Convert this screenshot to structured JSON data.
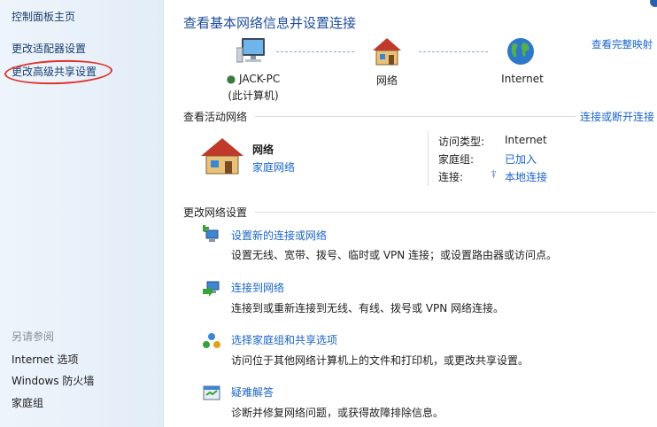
{
  "sidebar": {
    "home_link": "控制面板主页",
    "adapter_link": "更改适配器设置",
    "advanced_sharing_link": "更改高级共享设置",
    "see_also_heading": "另请参阅",
    "see_also": [
      "Internet 选项",
      "Windows 防火墙",
      "家庭组"
    ]
  },
  "header": {
    "title": "查看基本网络信息并设置连接",
    "full_map_link": "查看完整映射"
  },
  "network_map": {
    "computer_name": "JACK-PC",
    "computer_sub": "(此计算机)",
    "network_label": "网络",
    "internet_label": "Internet"
  },
  "active_networks": {
    "title": "查看活动网络",
    "connect_link": "连接或断开连接",
    "network_name": "网络",
    "network_type": "家庭网络",
    "access_type_label": "访问类型:",
    "access_type_value": "Internet",
    "homegroup_label": "家庭组:",
    "homegroup_value": "已加入",
    "connections_label": "连接:",
    "connections_value": "本地连接"
  },
  "change_settings": {
    "title": "更改网络设置",
    "tasks": [
      {
        "link": "设置新的连接或网络",
        "desc": "设置无线、宽带、拨号、临时或 VPN 连接；或设置路由器或访问点。"
      },
      {
        "link": "连接到网络",
        "desc": "连接到或重新连接到无线、有线、拨号或 VPN 网络连接。"
      },
      {
        "link": "选择家庭组和共享选项",
        "desc": "访问位于其他网络计算机上的文件和打印机，或更改共享设置。"
      },
      {
        "link": "疑难解答",
        "desc": "诊断并修复网络问题，或获得故障排除信息。"
      }
    ]
  },
  "colors": {
    "link": "#1a64c8",
    "title": "#1f4e9b",
    "highlight_oval": "#e0332b"
  }
}
